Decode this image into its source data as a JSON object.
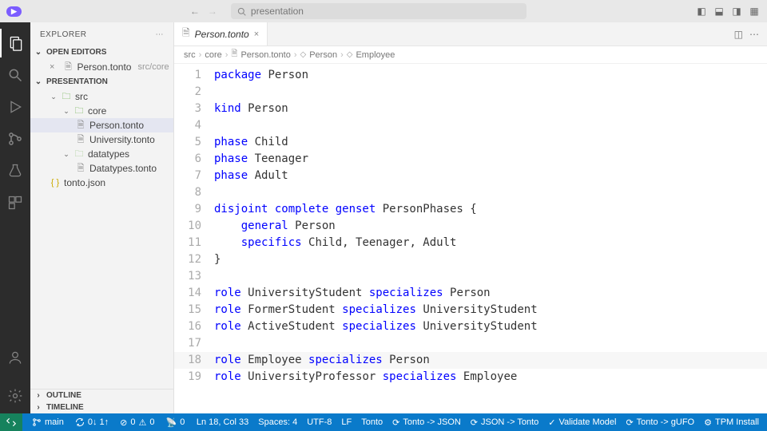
{
  "titlebar": {
    "badge": "▶",
    "search_placeholder": "presentation"
  },
  "sidebar": {
    "title": "EXPLORER",
    "open_editors_label": "OPEN EDITORS",
    "open_editors": [
      {
        "name": "Person.tonto",
        "path": "src/core"
      }
    ],
    "project_label": "PRESENTATION",
    "tree": {
      "src": "src",
      "core": "core",
      "person": "Person.tonto",
      "university": "University.tonto",
      "datatypes_folder": "datatypes",
      "datatypes_file": "Datatypes.tonto",
      "tonto_json": "tonto.json"
    },
    "outline": "OUTLINE",
    "timeline": "TIMELINE"
  },
  "tab": {
    "label": "Person.tonto"
  },
  "breadcrumbs": {
    "parts": [
      "src",
      "core",
      "Person.tonto",
      "Person",
      "Employee"
    ]
  },
  "code": [
    [
      {
        "t": "package ",
        "c": "kw"
      },
      {
        "t": "Person",
        "c": "idn"
      }
    ],
    [],
    [
      {
        "t": "kind ",
        "c": "kw"
      },
      {
        "t": "Person",
        "c": "idn"
      }
    ],
    [],
    [
      {
        "t": "phase ",
        "c": "kw"
      },
      {
        "t": "Child",
        "c": "idn"
      }
    ],
    [
      {
        "t": "phase ",
        "c": "kw"
      },
      {
        "t": "Teenager",
        "c": "idn"
      }
    ],
    [
      {
        "t": "phase ",
        "c": "kw"
      },
      {
        "t": "Adult",
        "c": "idn"
      }
    ],
    [],
    [
      {
        "t": "disjoint complete genset ",
        "c": "kw"
      },
      {
        "t": "PersonPhases {",
        "c": "idn"
      }
    ],
    [
      {
        "t": "    ",
        "c": ""
      },
      {
        "t": "general ",
        "c": "kw"
      },
      {
        "t": "Person",
        "c": "idn"
      }
    ],
    [
      {
        "t": "    ",
        "c": ""
      },
      {
        "t": "specifics ",
        "c": "kw"
      },
      {
        "t": "Child, Teenager, Adult",
        "c": "idn"
      }
    ],
    [
      {
        "t": "}",
        "c": "idn"
      }
    ],
    [],
    [
      {
        "t": "role ",
        "c": "kw"
      },
      {
        "t": "UniversityStudent ",
        "c": "idn"
      },
      {
        "t": "specializes ",
        "c": "kw"
      },
      {
        "t": "Person",
        "c": "idn"
      }
    ],
    [
      {
        "t": "role ",
        "c": "kw"
      },
      {
        "t": "FormerStudent ",
        "c": "idn"
      },
      {
        "t": "specializes ",
        "c": "kw"
      },
      {
        "t": "UniversityStudent",
        "c": "idn"
      }
    ],
    [
      {
        "t": "role ",
        "c": "kw"
      },
      {
        "t": "ActiveStudent ",
        "c": "idn"
      },
      {
        "t": "specializes ",
        "c": "kw"
      },
      {
        "t": "UniversityStudent",
        "c": "idn"
      }
    ],
    [],
    [
      {
        "t": "role ",
        "c": "kw"
      },
      {
        "t": "Employee ",
        "c": "idn"
      },
      {
        "t": "specializes ",
        "c": "kw"
      },
      {
        "t": "Person",
        "c": "idn"
      }
    ],
    [
      {
        "t": "role ",
        "c": "kw"
      },
      {
        "t": "UniversityProfessor ",
        "c": "idn"
      },
      {
        "t": "specializes ",
        "c": "kw"
      },
      {
        "t": "Employee",
        "c": "idn"
      }
    ]
  ],
  "highlight_line": 18,
  "statusbar": {
    "branch": "main",
    "sync": "0↓ 1↑",
    "errors": "0",
    "warnings": "0",
    "cursor": "Ln 18, Col 33",
    "spaces": "Spaces: 4",
    "encoding": "UTF-8",
    "eol": "LF",
    "lang": "Tonto",
    "actions": [
      "Tonto -> JSON",
      "JSON -> Tonto",
      "Validate Model",
      "Tonto -> gUFO",
      "TPM Install"
    ]
  }
}
